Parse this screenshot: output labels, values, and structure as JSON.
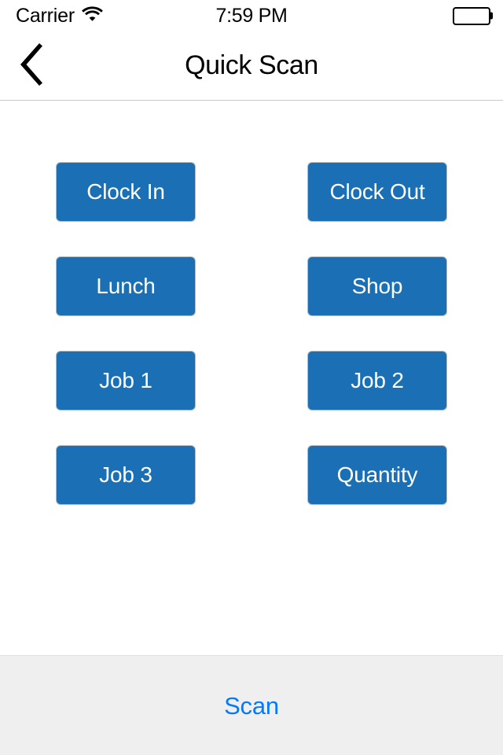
{
  "status_bar": {
    "carrier": "Carrier",
    "wifi_icon": "wifi-icon",
    "time": "7:59 PM",
    "battery_icon": "battery-full-icon"
  },
  "nav_bar": {
    "back_icon": "chevron-left-icon",
    "title": "Quick Scan"
  },
  "main": {
    "buttons": [
      {
        "label": "Clock In"
      },
      {
        "label": "Clock Out"
      },
      {
        "label": "Lunch"
      },
      {
        "label": "Shop"
      },
      {
        "label": "Job 1"
      },
      {
        "label": "Job 2"
      },
      {
        "label": "Job 3"
      },
      {
        "label": "Quantity"
      }
    ]
  },
  "toolbar": {
    "scan_label": "Scan"
  },
  "colors": {
    "button_blue": "#1a6fb5",
    "button_text": "#ffffff",
    "button_border": "#b6b9bd",
    "toolbar_bg": "#efefef",
    "accent_blue": "#007aff",
    "nav_separator": "#c8c8c8",
    "page_bg": "#ffffff",
    "text_black": "#000000"
  }
}
